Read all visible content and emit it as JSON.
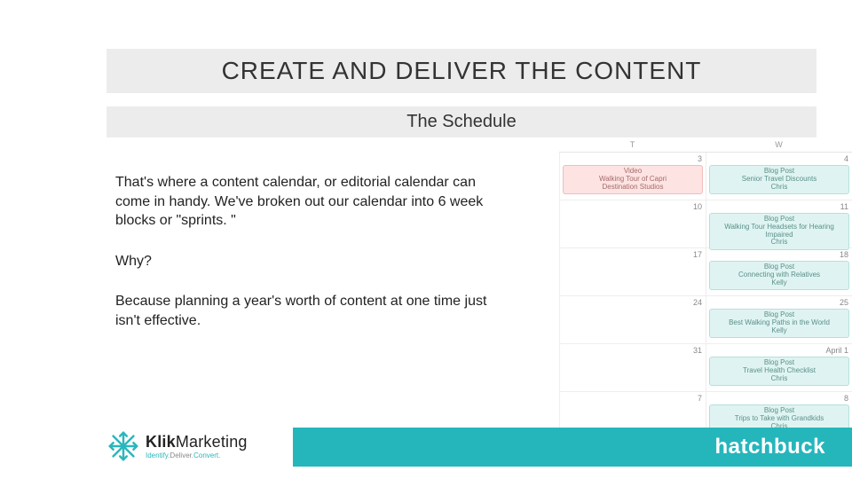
{
  "title": "CREATE AND DELIVER THE CONTENT",
  "subtitle": "The Schedule",
  "paragraphs": {
    "p1": "That's where a content calendar, or editorial calendar can come in handy.  We've broken out our calendar into 6 week blocks or \"sprints. \"",
    "p2": "Why?",
    "p3": "Because planning a year's worth of content at one time just isn't effective."
  },
  "calendar": {
    "headers": {
      "t": "T",
      "w": "W"
    },
    "rows": [
      {
        "left": {
          "date": "3",
          "card": {
            "variant": "pink",
            "title": "Video",
            "line": "Walking Tour of Capri",
            "author": "Destination Studios"
          }
        },
        "right": {
          "date": "4",
          "card": {
            "variant": "teal",
            "title": "Blog Post",
            "line": "Senior Travel Discounts",
            "author": "Chris"
          }
        }
      },
      {
        "left": {
          "date": "10"
        },
        "right": {
          "date": "11",
          "card": {
            "variant": "teal",
            "title": "Blog Post",
            "line": "Walking Tour Headsets for Hearing Impaired",
            "author": "Chris"
          }
        }
      },
      {
        "left": {
          "date": "17"
        },
        "right": {
          "date": "18",
          "card": {
            "variant": "teal",
            "title": "Blog Post",
            "line": "Connecting with Relatives",
            "author": "Kelly"
          }
        }
      },
      {
        "left": {
          "date": "24"
        },
        "right": {
          "date": "25",
          "card": {
            "variant": "teal",
            "title": "Blog Post",
            "line": "Best Walking Paths in the World",
            "author": "Kelly"
          }
        }
      },
      {
        "left": {
          "date": "31"
        },
        "right": {
          "date": "April  1",
          "card": {
            "variant": "teal",
            "title": "Blog Post",
            "line": "Travel Health Checklist",
            "author": "Chris"
          }
        }
      },
      {
        "left": {
          "date": "7"
        },
        "right": {
          "date": "8",
          "card": {
            "variant": "teal",
            "title": "Blog Post",
            "line": "Trips to Take with Grandkids",
            "author": "Chris"
          }
        }
      }
    ]
  },
  "footer": {
    "klik_brand_bold": "Klik",
    "klik_brand_light": "Marketing",
    "klik_tag_a": "Identify.",
    "klik_tag_b": "Deliver.",
    "klik_tag_c": "Convert.",
    "hatchbuck": "hatchbuck"
  }
}
